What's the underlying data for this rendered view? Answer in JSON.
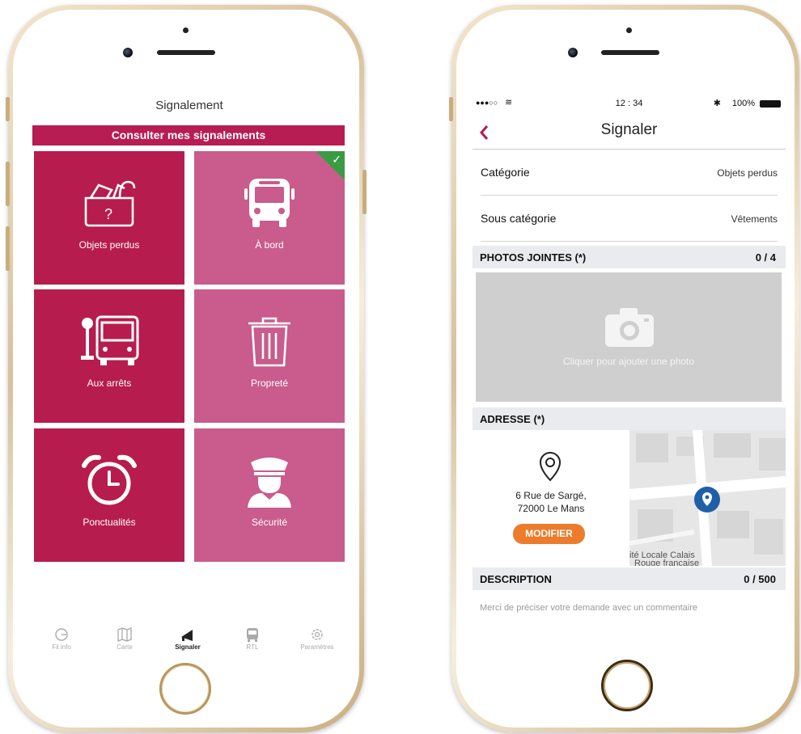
{
  "left_phone": {
    "title": "Signalement",
    "consult_button": "Consulter mes signalements",
    "tiles": [
      {
        "label": "Objets perdus",
        "icon": "lost-items-icon",
        "checked": false
      },
      {
        "label": "À bord",
        "icon": "bus-icon",
        "checked": true
      },
      {
        "label": "Aux arrêts",
        "icon": "bus-stop-icon",
        "checked": false
      },
      {
        "label": "Propreté",
        "icon": "trash-icon",
        "checked": false
      },
      {
        "label": "Ponctualités",
        "icon": "alarm-clock-icon",
        "checked": false
      },
      {
        "label": "Sécurité",
        "icon": "security-agent-icon",
        "checked": false
      }
    ],
    "tabs": [
      {
        "label": "Fil info",
        "icon": "news-feed-icon",
        "active": false
      },
      {
        "label": "Carte",
        "icon": "map-icon",
        "active": false
      },
      {
        "label": "Signaler",
        "icon": "megaphone-icon",
        "active": true
      },
      {
        "label": "RTL",
        "icon": "bus-icon",
        "active": false
      },
      {
        "label": "Paramètres",
        "icon": "gear-icon",
        "active": false
      }
    ]
  },
  "right_phone": {
    "status_bar": {
      "signal": "●●●○○",
      "time": "12 : 34",
      "battery": "100%"
    },
    "nav_title": "Signaler",
    "fields": [
      {
        "label": "Catégorie",
        "value": "Objets perdus"
      },
      {
        "label": "Sous catégorie",
        "value": "Vêtements"
      }
    ],
    "photos": {
      "header": "PHOTOS JOINTES (*)",
      "count": "0 / 4",
      "hint": "Cliquer pour ajouter une photo"
    },
    "address": {
      "header": "ADRESSE (*)",
      "line1": "6 Rue de Sargé,",
      "line2": "72000 Le Mans",
      "button": "MODIFIER",
      "map_labels": [
        "ité Locale Calais",
        "Rouge française"
      ]
    },
    "description": {
      "header": "DESCRIPTION",
      "count": "0 / 500",
      "placeholder": "Merci de préciser votre demande avec un commentaire"
    }
  },
  "colors": {
    "brand_dark": "#b71c4e",
    "brand_light": "#c95c8c",
    "check_green": "#3a9b44",
    "orange": "#ec7b2b",
    "pin_blue": "#1f5fa8"
  }
}
